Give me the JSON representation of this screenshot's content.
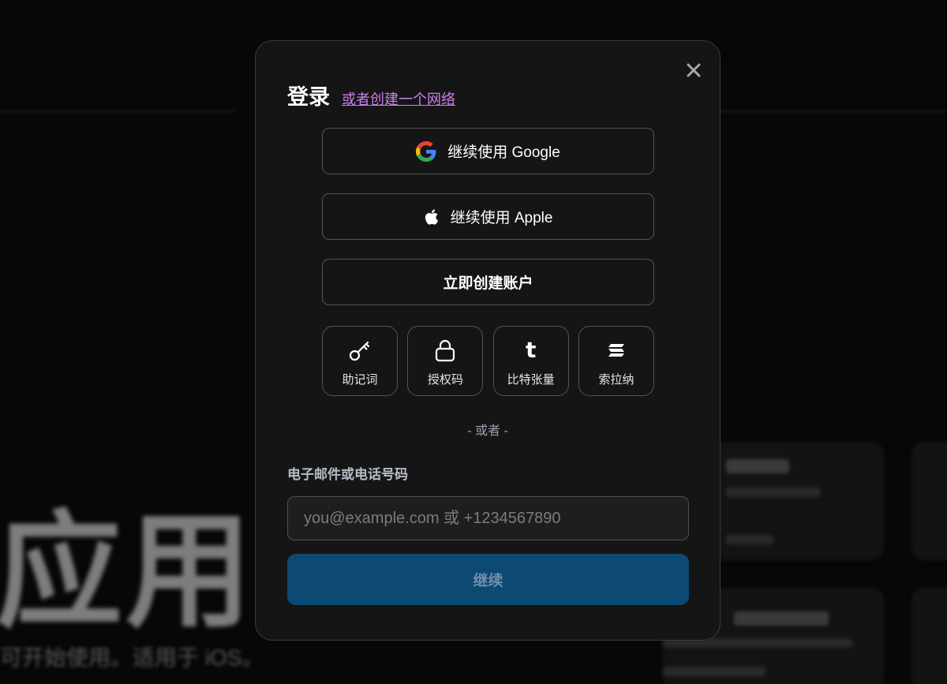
{
  "background": {
    "hero_text": "应用",
    "hero_subtext": "可开始使用。适用于 iOS。"
  },
  "modal": {
    "title": "登录",
    "create_link": "或者创建一个网络",
    "buttons": {
      "google": "继续使用 Google",
      "apple": "继续使用 Apple",
      "create_account": "立即创建账户"
    },
    "tiles": [
      {
        "label": "助记词",
        "icon": "key-icon"
      },
      {
        "label": "授权码",
        "icon": "lock-icon"
      },
      {
        "label": "比特张量",
        "icon": "tumblr-t-icon"
      },
      {
        "label": "索拉纳",
        "icon": "solana-icon"
      }
    ],
    "divider": "- 或者 -",
    "field_label": "电子邮件或电话号码",
    "input": {
      "value": "",
      "placeholder": "you@example.com 或 +1234567890"
    },
    "continue_label": "继续"
  },
  "colors": {
    "link": "#c880ee",
    "primary_button": "#0c4a73",
    "modal_bg": "#151515"
  }
}
